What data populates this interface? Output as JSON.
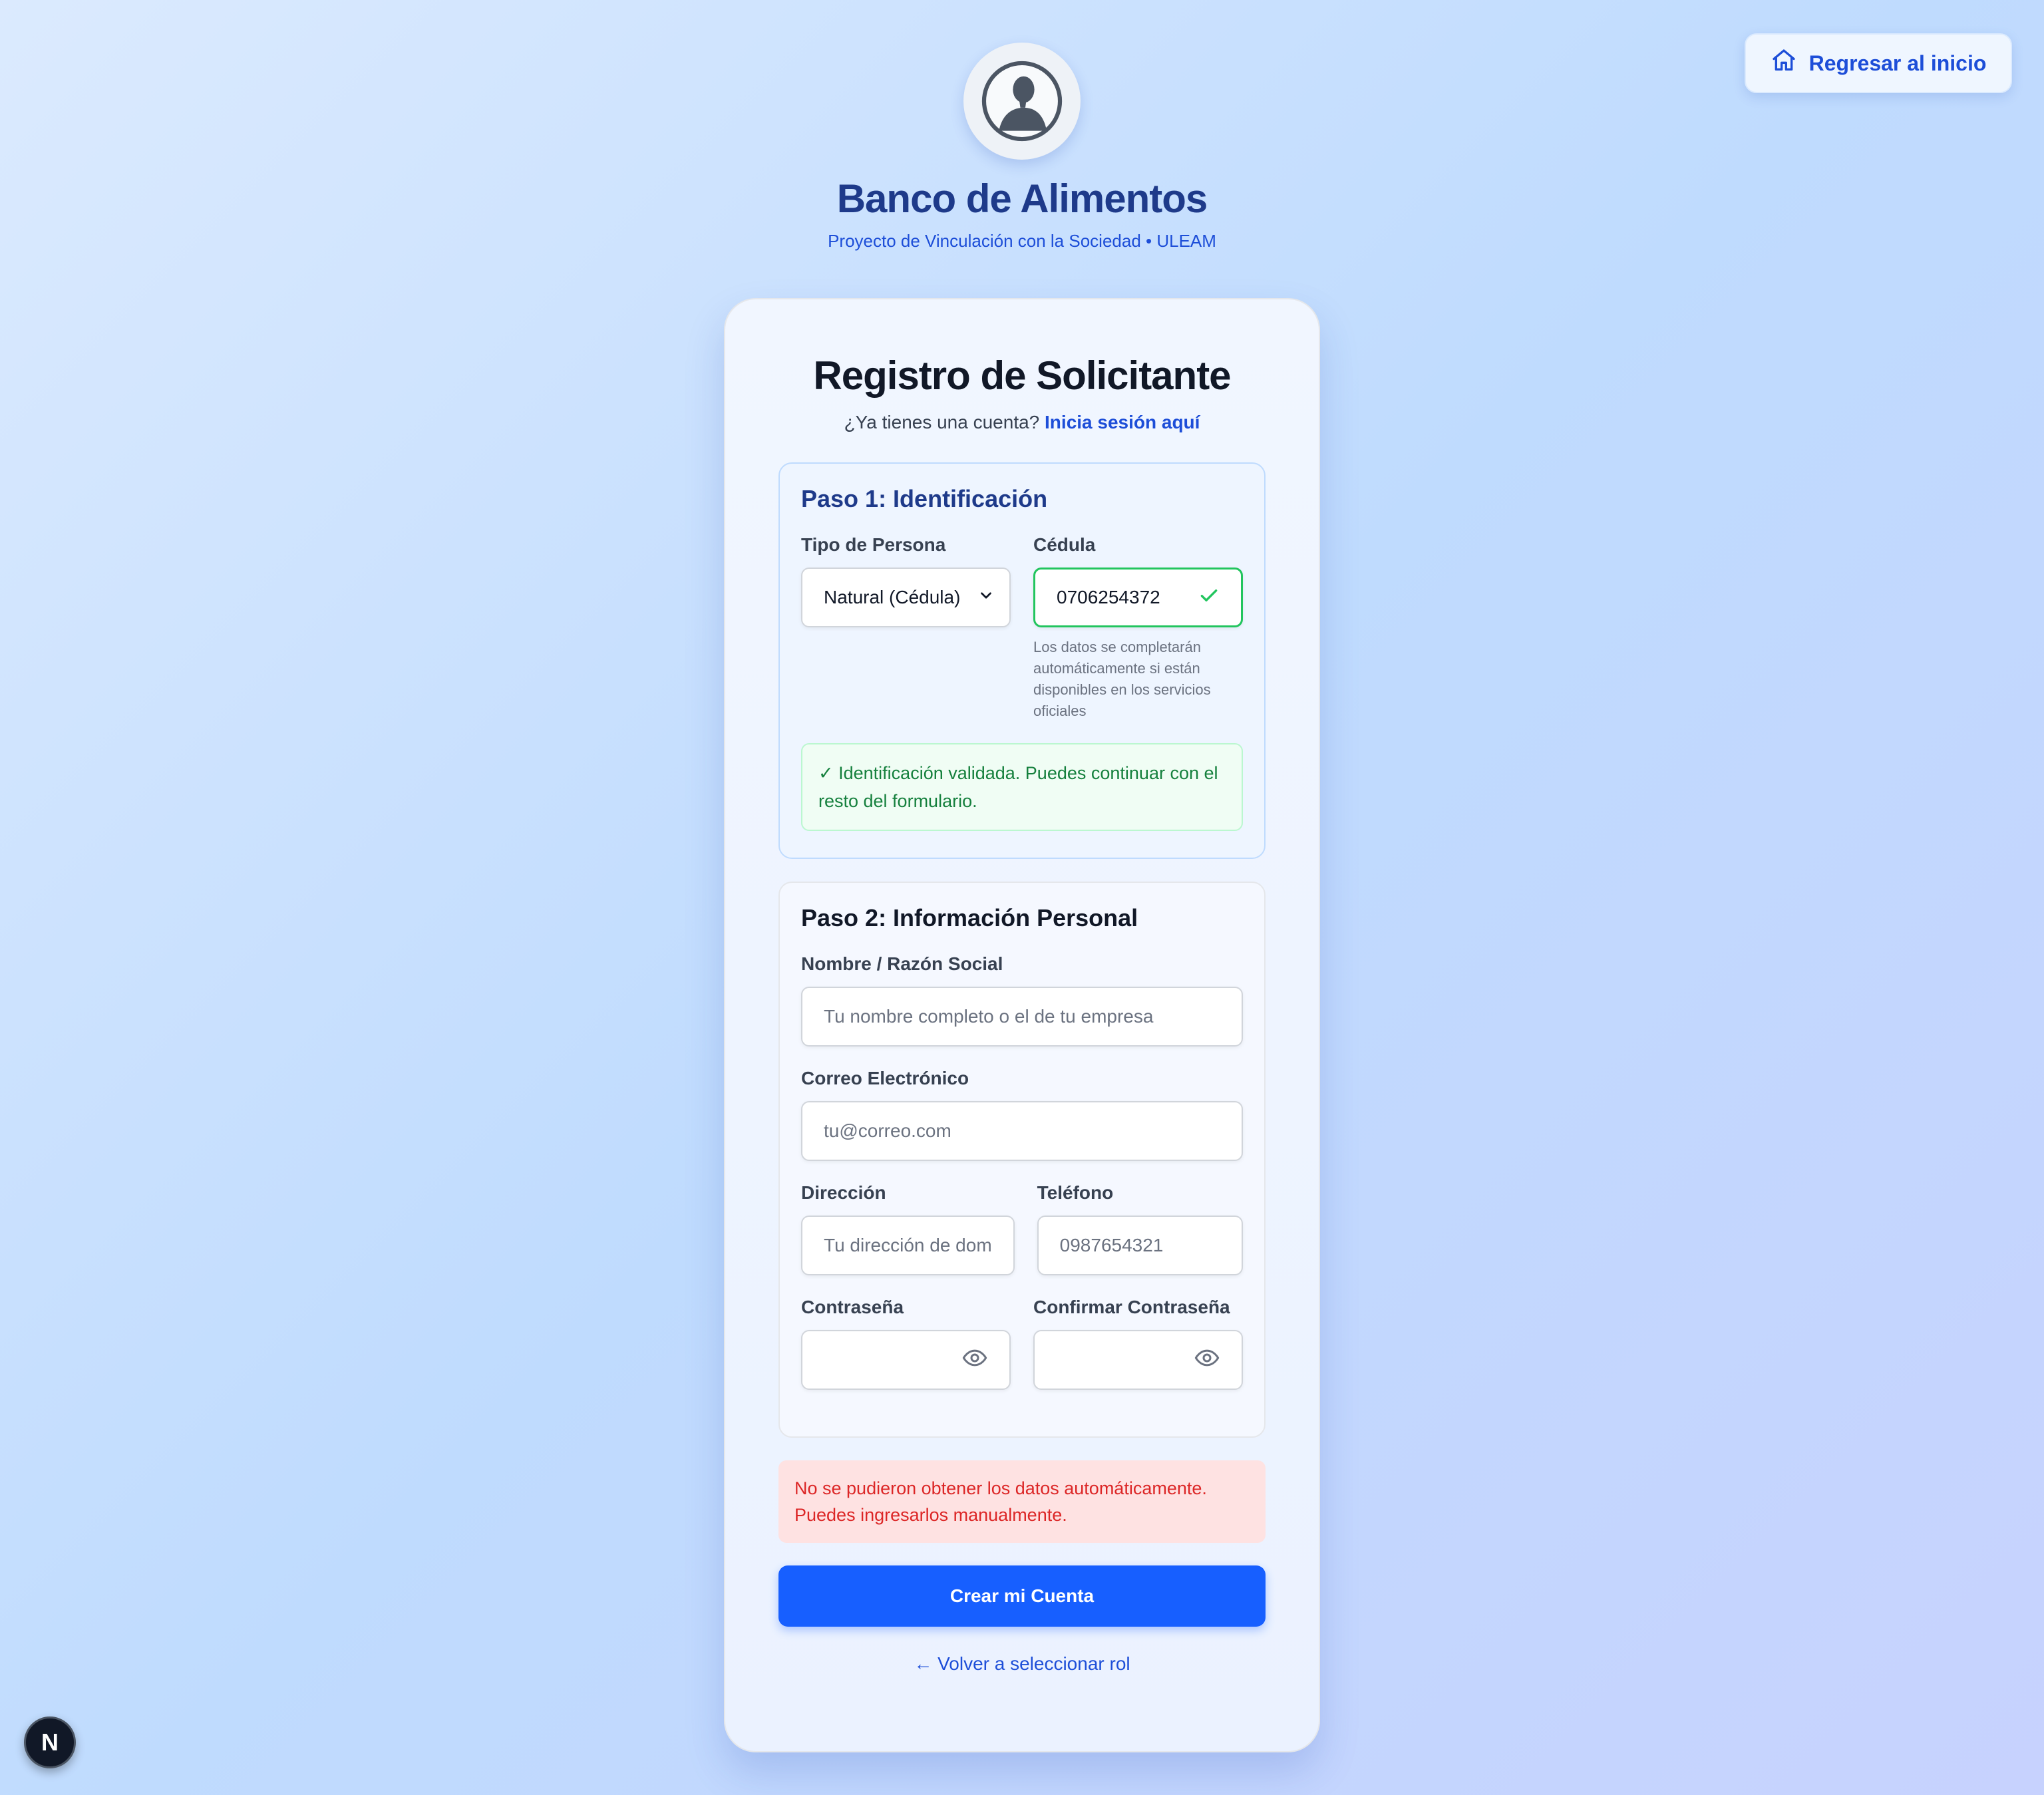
{
  "nav": {
    "home_label": "Regresar al inicio"
  },
  "brand": {
    "title": "Banco de Alimentos",
    "subtitle": "Proyecto de Vinculación con la Sociedad • ULEAM"
  },
  "form": {
    "title": "Registro de Solicitante",
    "have_account": "¿Ya tienes una cuenta?",
    "login_link": "Inicia sesión aquí",
    "step1": {
      "title": "Paso 1: Identificación",
      "person_type_label": "Tipo de Persona",
      "person_type_value": "Natural (Cédula)",
      "id_label": "Cédula",
      "id_value": "0706254372",
      "id_hint": "Los datos se completarán automáticamente si están disponibles en los servicios oficiales",
      "success_message": "✓ Identificación validada. Puedes continuar con el resto del formulario."
    },
    "step2": {
      "title": "Paso 2: Información Personal",
      "name_label": "Nombre / Razón Social",
      "name_placeholder": "Tu nombre completo o el de tu empresa",
      "email_label": "Correo Electrónico",
      "email_placeholder": "tu@correo.com",
      "address_label": "Dirección",
      "address_placeholder": "Tu dirección de dom",
      "phone_label": "Teléfono",
      "phone_placeholder": "0987654321",
      "password_label": "Contraseña",
      "confirm_password_label": "Confirmar Contraseña"
    },
    "error_message": "No se pudieron obtener los datos automáticamente. Puedes ingresarlos manualmente.",
    "submit_label": "Crear mi Cuenta",
    "back_label": "← Volver a seleccionar rol"
  },
  "badge": {
    "letter": "N"
  },
  "icons": {
    "home": "home-icon",
    "logo": "portrait-logo",
    "chevron": "chevron-down-icon",
    "check": "check-icon",
    "eye": "eye-icon"
  },
  "colors": {
    "primary": "#175fff",
    "brand_title": "#1e3a8a",
    "success": "#22c55e",
    "error": "#dc2626"
  }
}
